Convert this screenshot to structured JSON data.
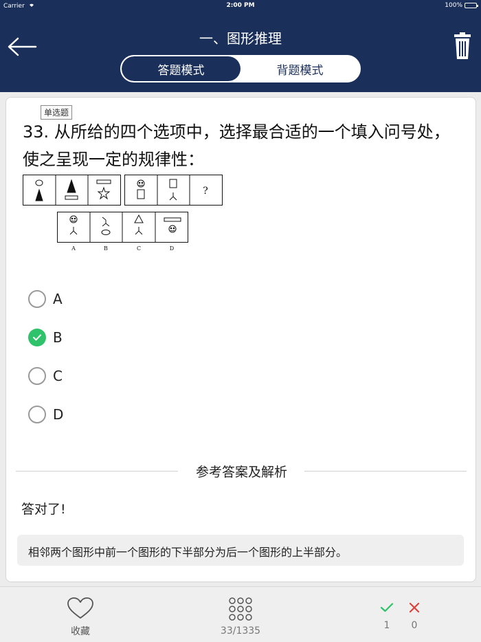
{
  "status": {
    "carrier": "Carrier",
    "time": "2:00 PM",
    "battery": "100%",
    "battery_level": 1.0
  },
  "header": {
    "title": "一、图形推理"
  },
  "segment": {
    "mode_answer": "答题模式",
    "mode_recite": "背题模式",
    "selected": "答题模式"
  },
  "question": {
    "type_badge": "单选题",
    "text": "33. 从所给的四个选项中，选择最合适的一个填入问号处，使之呈现一定的规律性：",
    "figure_question_mark": "?",
    "figure_labels": [
      "A",
      "B",
      "C",
      "D"
    ]
  },
  "options": [
    {
      "label": "A",
      "checked": false
    },
    {
      "label": "B",
      "checked": true
    },
    {
      "label": "C",
      "checked": false
    },
    {
      "label": "D",
      "checked": false
    }
  ],
  "analysis": {
    "heading": "参考答案及解析",
    "result": "答对了!",
    "explanation": "相邻两个图形中前一个图形的下半部分为后一个图形的上半部分。"
  },
  "bottom": {
    "favorite_label": "收藏",
    "progress": "33/1335",
    "correct_count": "1",
    "wrong_count": "0"
  },
  "colors": {
    "navy": "#1b2f5b",
    "green": "#2ec26a",
    "red": "#e0403a"
  },
  "icons": [
    "back-arrow-icon",
    "trash-icon",
    "check-icon",
    "heart-icon",
    "grid-dots-icon",
    "close-icon"
  ]
}
